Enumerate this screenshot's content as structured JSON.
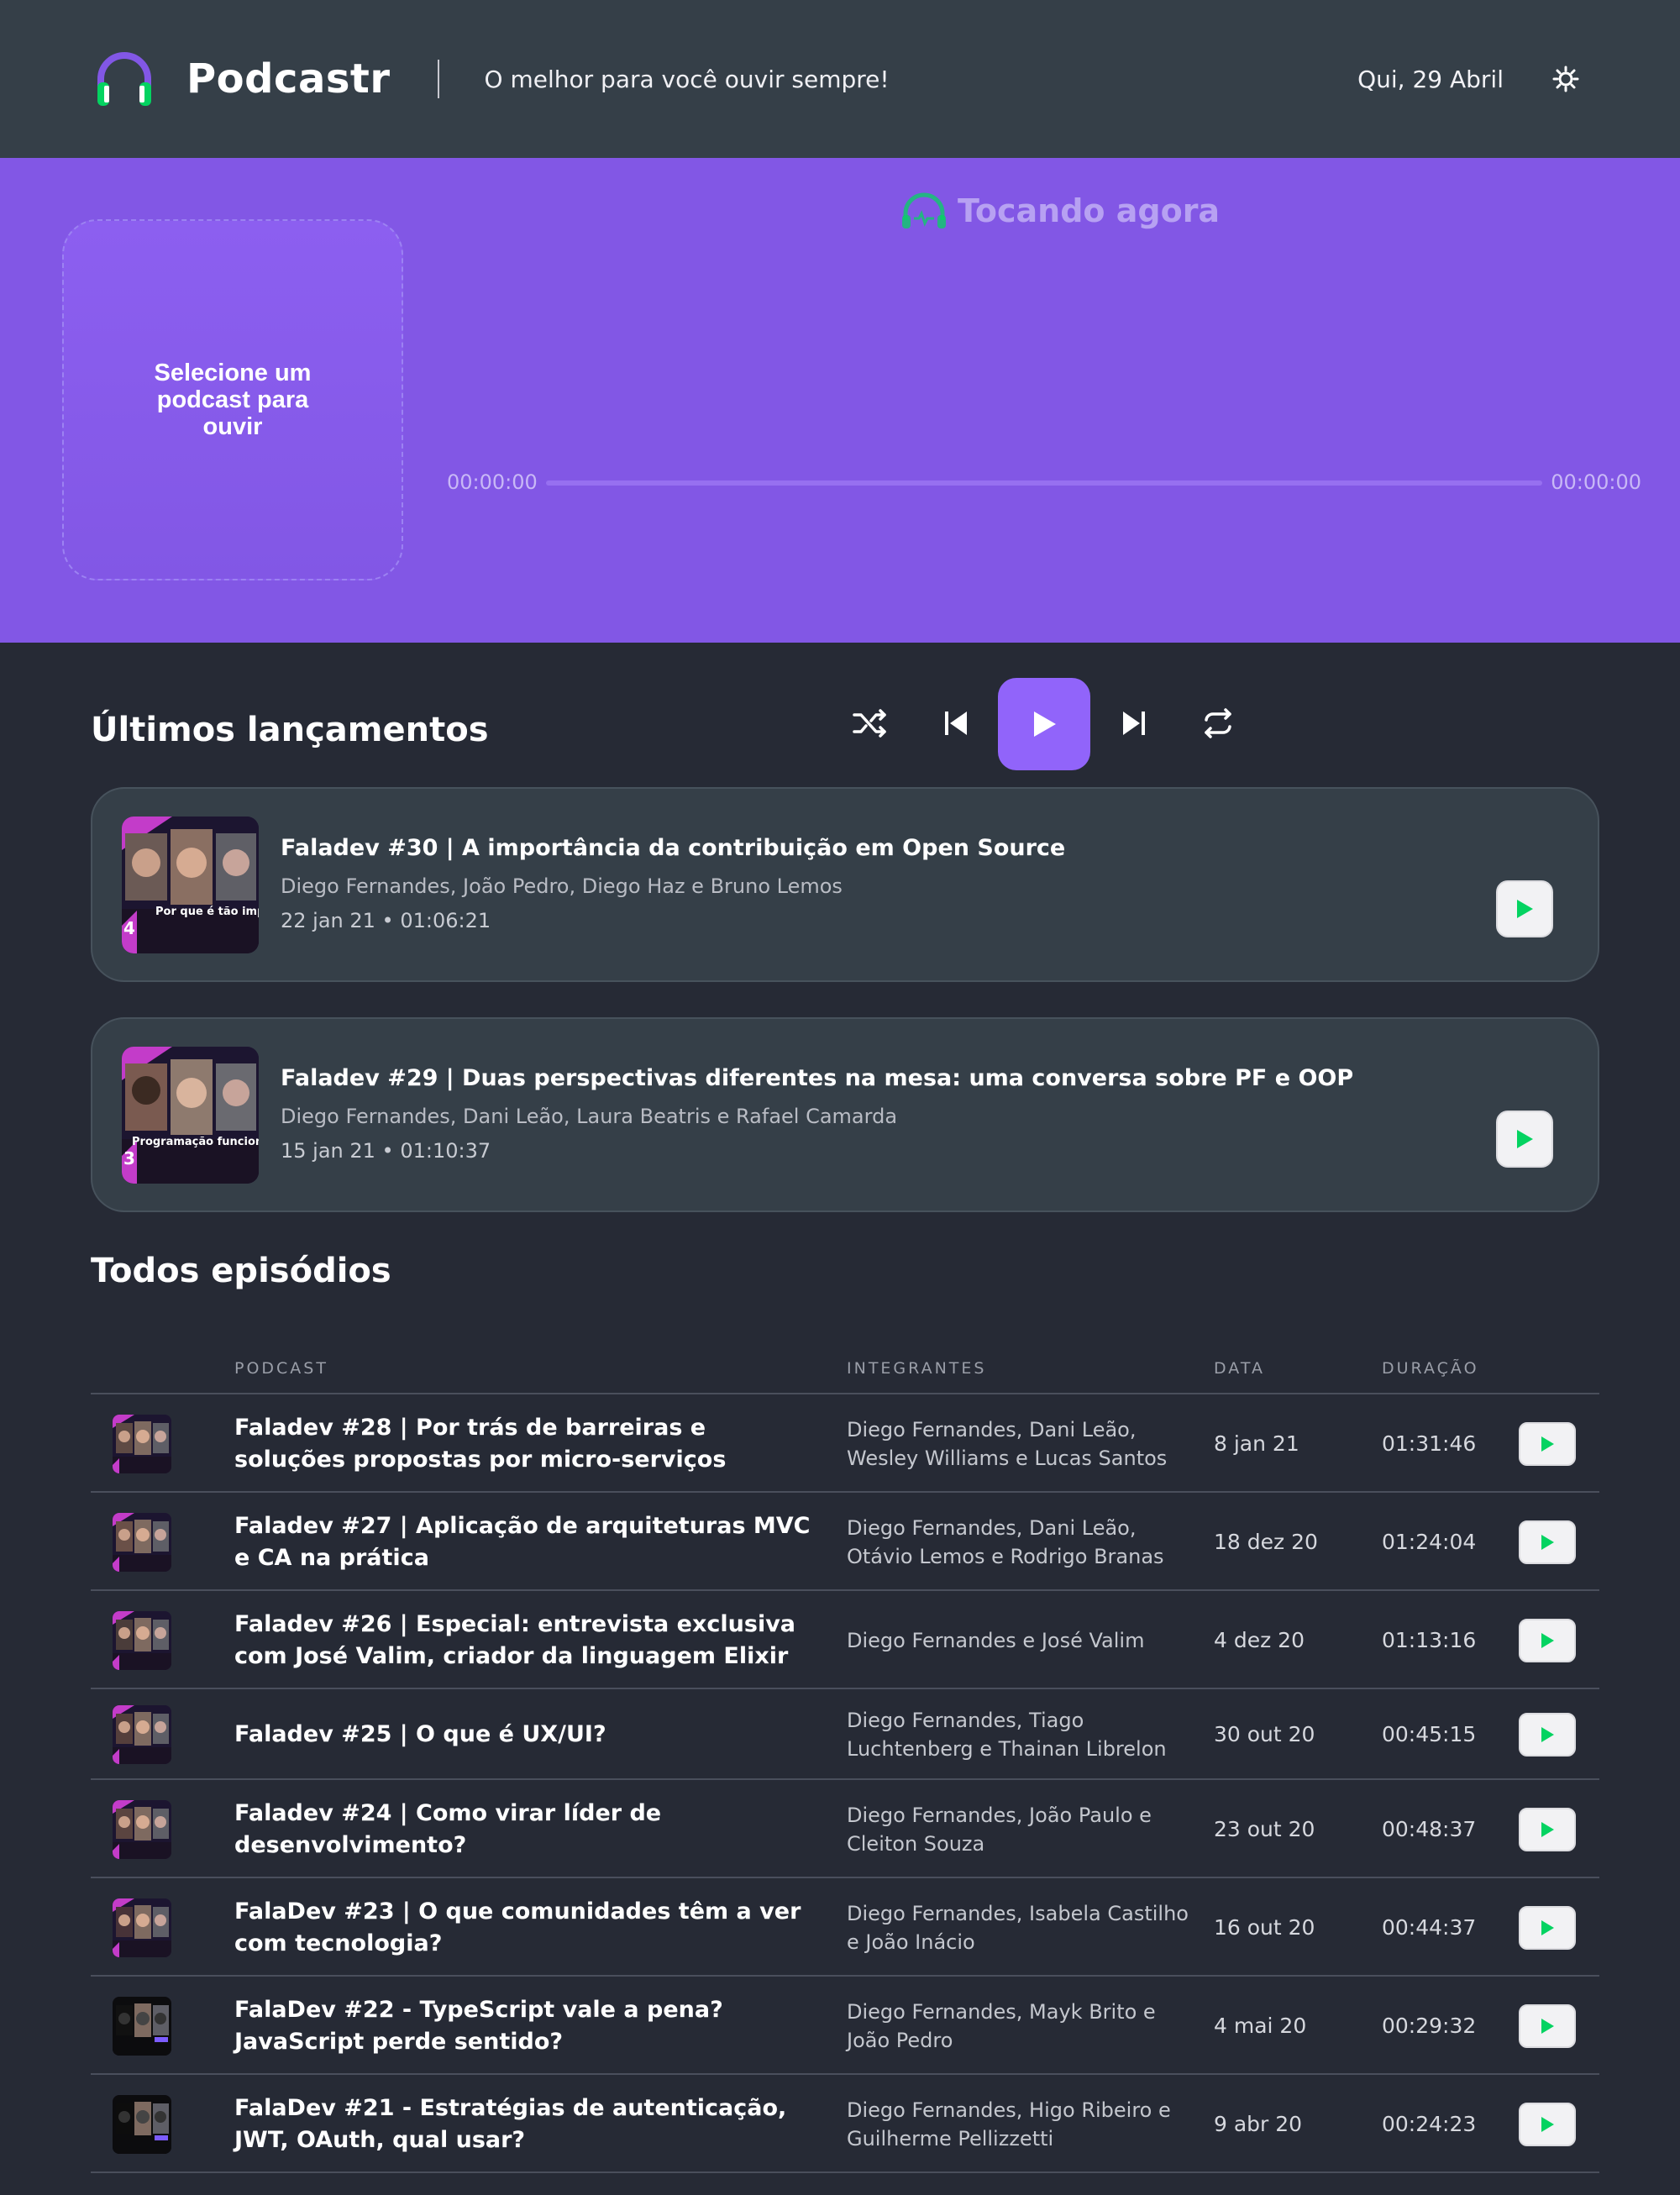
{
  "header": {
    "brand": "Podcastr",
    "tagline": "O melhor para você ouvir sempre!",
    "date": "Qui, 29 Abril",
    "theme_icon": "sun-gear-icon"
  },
  "player": {
    "now_playing_label": "Tocando agora",
    "placeholder": "Selecione um podcast para ouvir",
    "current_time": "00:00:00",
    "total_time": "00:00:00",
    "progress": 0,
    "controls": [
      "shuffle-icon",
      "previous-icon",
      "play-icon",
      "next-icon",
      "repeat-icon"
    ]
  },
  "latest": {
    "title": "Últimos lançamentos",
    "items": [
      {
        "title": "Faladev #30 | A importância da contribuição em Open Source",
        "members": "Diego Fernandes, João Pedro, Diego Haz e Bruno Lemos",
        "meta": "22 jan 21 • 01:06:21",
        "thumb_caption": "Por que é tão imp contribuir em Open S",
        "thumb_number": "4"
      },
      {
        "title": "Faladev #29 | Duas perspectivas diferentes na mesa: uma conversa sobre PF e OOP",
        "members": "Diego Fernandes, Dani Leão, Laura Beatris e Rafael Camarda",
        "meta": "15 jan 21 • 01:10:37",
        "thumb_caption": "Programação funcion devs orientados a c",
        "thumb_number": "3"
      }
    ]
  },
  "all": {
    "title": "Todos episódios",
    "columns": [
      "PODCAST",
      "INTEGRANTES",
      "DATA",
      "DURAÇÃO"
    ],
    "rows": [
      {
        "title": "Faladev #28 | Por trás de barreiras e soluções propostas por micro-serviços",
        "members": "Diego Fernandes, Dani Leão, Wesley Williams e Lucas Santos",
        "date": "8 jan 21",
        "duration": "01:31:46"
      },
      {
        "title": "Faladev #27 | Aplicação de arquiteturas MVC e CA na prática",
        "members": "Diego Fernandes, Dani Leão, Otávio Lemos e Rodrigo Branas",
        "date": "18 dez 20",
        "duration": "01:24:04"
      },
      {
        "title": "Faladev #26 | Especial: entrevista exclusiva com José Valim, criador da linguagem Elixir",
        "members": "Diego Fernandes e José Valim",
        "date": "4 dez 20",
        "duration": "01:13:16"
      },
      {
        "title": "Faladev #25 | O que é UX/UI?",
        "members": "Diego Fernandes, Tiago Luchtenberg e Thainan Librelon",
        "date": "30 out 20",
        "duration": "00:45:15"
      },
      {
        "title": "Faladev #24 | Como virar líder de desenvolvimento?",
        "members": "Diego Fernandes, João Paulo e Cleiton Souza",
        "date": "23 out 20",
        "duration": "00:48:37"
      },
      {
        "title": "FalaDev #23 | O que comunidades têm a ver com tecnologia?",
        "members": "Diego Fernandes, Isabela Castilho e João Inácio",
        "date": "16 out 20",
        "duration": "00:44:37"
      },
      {
        "title": "FalaDev #22 - TypeScript vale a pena? JavaScript perde sentido?",
        "members": "Diego Fernandes, Mayk Brito e João Pedro",
        "date": "4 mai 20",
        "duration": "00:29:32"
      },
      {
        "title": "FalaDev #21 - Estratégias de autenticação, JWT, OAuth, qual usar?",
        "members": "Diego Fernandes, Higo Ribeiro e Guilherme Pellizzetti",
        "date": "9 abr 20",
        "duration": "00:24:23"
      }
    ]
  },
  "colors": {
    "header_bg": "#353f48",
    "player_bg": "#8257e5",
    "page_bg": "#262a35",
    "card_bg": "#353f48",
    "accent_green": "#04d361"
  }
}
